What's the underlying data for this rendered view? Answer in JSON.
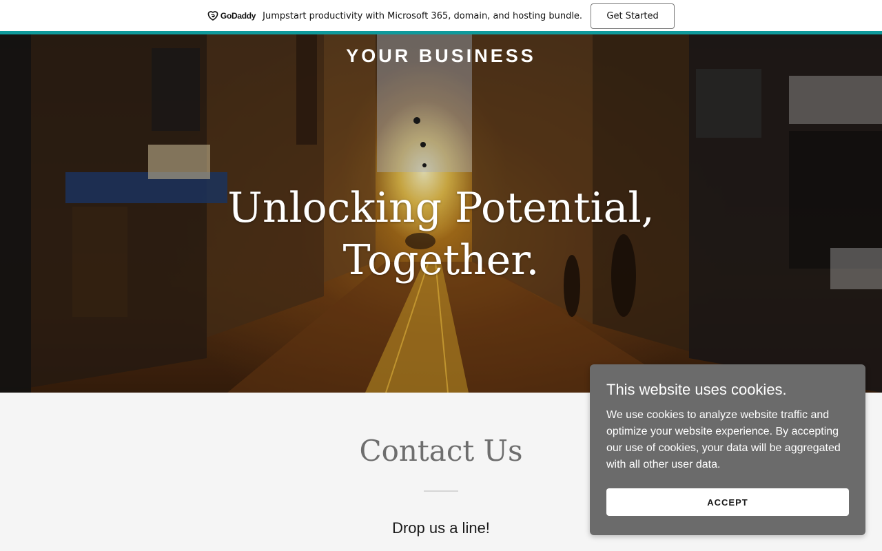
{
  "promo": {
    "logo_text": "GoDaddy",
    "message": "Jumpstart productivity with Microsoft 365, domain, and hosting bundle.",
    "cta_label": "Get Started"
  },
  "hero": {
    "brand": "YOUR BUSINESS",
    "title": "Unlocking Potential, Together."
  },
  "contact": {
    "title": "Contact Us",
    "subtitle": "Drop us a line!"
  },
  "cookie": {
    "title": "This website uses cookies.",
    "body": "We use cookies to analyze website traffic and optimize your website experience. By accepting our use of cookies, your data will be aggregated with all other user data.",
    "accept_label": "ACCEPT"
  },
  "colors": {
    "accent": "#0f9a9c",
    "cookie_bg": "#6b6b6b"
  }
}
